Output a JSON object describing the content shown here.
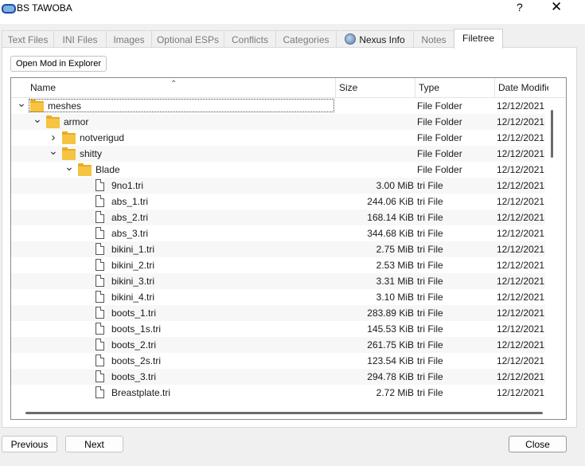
{
  "window": {
    "title": "BS TAWOBA",
    "help": "?",
    "close": "✕"
  },
  "tabs": [
    {
      "label": "Text Files",
      "active": false
    },
    {
      "label": "INI Files",
      "active": false
    },
    {
      "label": "Images",
      "active": false
    },
    {
      "label": "Optional ESPs",
      "active": false
    },
    {
      "label": "Conflicts",
      "active": false
    },
    {
      "label": "Categories",
      "active": false
    },
    {
      "label": "Nexus Info",
      "active": false,
      "icon": "globe-icon"
    },
    {
      "label": "Notes",
      "active": false
    },
    {
      "label": "Filetree",
      "active": true
    }
  ],
  "toolbar": {
    "open_mod": "Open Mod in Explorer"
  },
  "columns": {
    "name": "Name",
    "size": "Size",
    "type": "Type",
    "date": "Date Modified"
  },
  "rows": [
    {
      "name": "meshes",
      "kind": "folder",
      "depth": 0,
      "expand": "down",
      "size": "",
      "type": "File Folder",
      "date": "12/12/2021",
      "selected": true
    },
    {
      "name": "armor",
      "kind": "folder",
      "depth": 1,
      "expand": "down",
      "size": "",
      "type": "File Folder",
      "date": "12/12/2021"
    },
    {
      "name": "notverigud",
      "kind": "folder",
      "depth": 2,
      "expand": "right",
      "size": "",
      "type": "File Folder",
      "date": "12/12/2021"
    },
    {
      "name": "shitty",
      "kind": "folder",
      "depth": 2,
      "expand": "down",
      "size": "",
      "type": "File Folder",
      "date": "12/12/2021"
    },
    {
      "name": "Blade",
      "kind": "folder",
      "depth": 3,
      "expand": "down",
      "size": "",
      "type": "File Folder",
      "date": "12/12/2021"
    },
    {
      "name": "9no1.tri",
      "kind": "file",
      "depth": 4,
      "size": "3.00 MiB",
      "type": "tri File",
      "date": "12/12/2021"
    },
    {
      "name": "abs_1.tri",
      "kind": "file",
      "depth": 4,
      "size": "244.06 KiB",
      "type": "tri File",
      "date": "12/12/2021"
    },
    {
      "name": "abs_2.tri",
      "kind": "file",
      "depth": 4,
      "size": "168.14 KiB",
      "type": "tri File",
      "date": "12/12/2021"
    },
    {
      "name": "abs_3.tri",
      "kind": "file",
      "depth": 4,
      "size": "344.68 KiB",
      "type": "tri File",
      "date": "12/12/2021"
    },
    {
      "name": "bikini_1.tri",
      "kind": "file",
      "depth": 4,
      "size": "2.75 MiB",
      "type": "tri File",
      "date": "12/12/2021"
    },
    {
      "name": "bikini_2.tri",
      "kind": "file",
      "depth": 4,
      "size": "2.53 MiB",
      "type": "tri File",
      "date": "12/12/2021"
    },
    {
      "name": "bikini_3.tri",
      "kind": "file",
      "depth": 4,
      "size": "3.31 MiB",
      "type": "tri File",
      "date": "12/12/2021"
    },
    {
      "name": "bikini_4.tri",
      "kind": "file",
      "depth": 4,
      "size": "3.10 MiB",
      "type": "tri File",
      "date": "12/12/2021"
    },
    {
      "name": "boots_1.tri",
      "kind": "file",
      "depth": 4,
      "size": "283.89 KiB",
      "type": "tri File",
      "date": "12/12/2021"
    },
    {
      "name": "boots_1s.tri",
      "kind": "file",
      "depth": 4,
      "size": "145.53 KiB",
      "type": "tri File",
      "date": "12/12/2021"
    },
    {
      "name": "boots_2.tri",
      "kind": "file",
      "depth": 4,
      "size": "261.75 KiB",
      "type": "tri File",
      "date": "12/12/2021"
    },
    {
      "name": "boots_2s.tri",
      "kind": "file",
      "depth": 4,
      "size": "123.54 KiB",
      "type": "tri File",
      "date": "12/12/2021"
    },
    {
      "name": "boots_3.tri",
      "kind": "file",
      "depth": 4,
      "size": "294.78 KiB",
      "type": "tri File",
      "date": "12/12/2021"
    },
    {
      "name": "Breastplate.tri",
      "kind": "file",
      "depth": 4,
      "size": "2.72 MiB",
      "type": "tri File",
      "date": "12/12/2021"
    }
  ],
  "footer": {
    "previous": "Previous",
    "next": "Next",
    "close": "Close"
  }
}
